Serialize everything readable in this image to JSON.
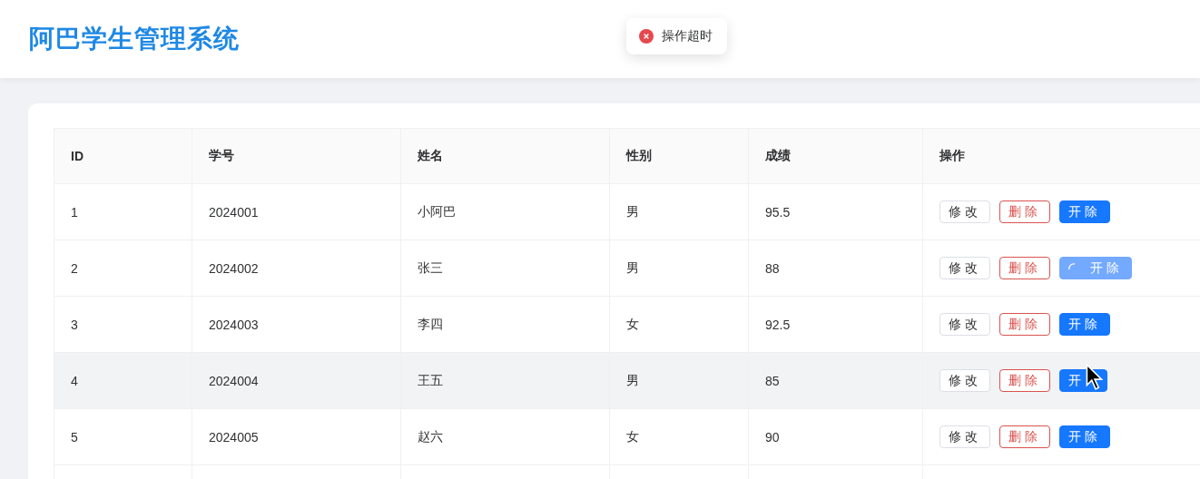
{
  "header": {
    "title": "阿巴学生管理系统"
  },
  "toast": {
    "kind": "error",
    "message": "操作超时"
  },
  "table": {
    "columns": [
      "ID",
      "学号",
      "姓名",
      "性别",
      "成绩",
      "操作"
    ],
    "rows": [
      {
        "cells": [
          "1",
          "2024001",
          "小阿巴",
          "男",
          "95.5"
        ],
        "hovered": false,
        "actions": [
          {
            "kind": "edit",
            "label": "修改"
          },
          {
            "kind": "delete",
            "label": "删除"
          },
          {
            "kind": "expel",
            "label": "开除",
            "loading": false
          }
        ]
      },
      {
        "cells": [
          "2",
          "2024002",
          "张三",
          "男",
          "88"
        ],
        "hovered": false,
        "actions": [
          {
            "kind": "edit",
            "label": "修改"
          },
          {
            "kind": "delete",
            "label": "删除"
          },
          {
            "kind": "expel",
            "label": "开除",
            "loading": true
          }
        ]
      },
      {
        "cells": [
          "3",
          "2024003",
          "李四",
          "女",
          "92.5"
        ],
        "hovered": false,
        "actions": [
          {
            "kind": "edit",
            "label": "修改"
          },
          {
            "kind": "delete",
            "label": "删除"
          },
          {
            "kind": "expel",
            "label": "开除",
            "loading": false
          }
        ]
      },
      {
        "cells": [
          "4",
          "2024004",
          "王五",
          "男",
          "85"
        ],
        "hovered": true,
        "cursor": true,
        "actions": [
          {
            "kind": "edit",
            "label": "修改"
          },
          {
            "kind": "delete",
            "label": "删除"
          },
          {
            "kind": "expel",
            "label": "开",
            "loading": false
          }
        ]
      },
      {
        "cells": [
          "5",
          "2024005",
          "赵六",
          "女",
          "90"
        ],
        "hovered": false,
        "actions": [
          {
            "kind": "edit",
            "label": "修改"
          },
          {
            "kind": "delete",
            "label": "删除"
          },
          {
            "kind": "expel",
            "label": "开除",
            "loading": false
          }
        ]
      }
    ]
  }
}
